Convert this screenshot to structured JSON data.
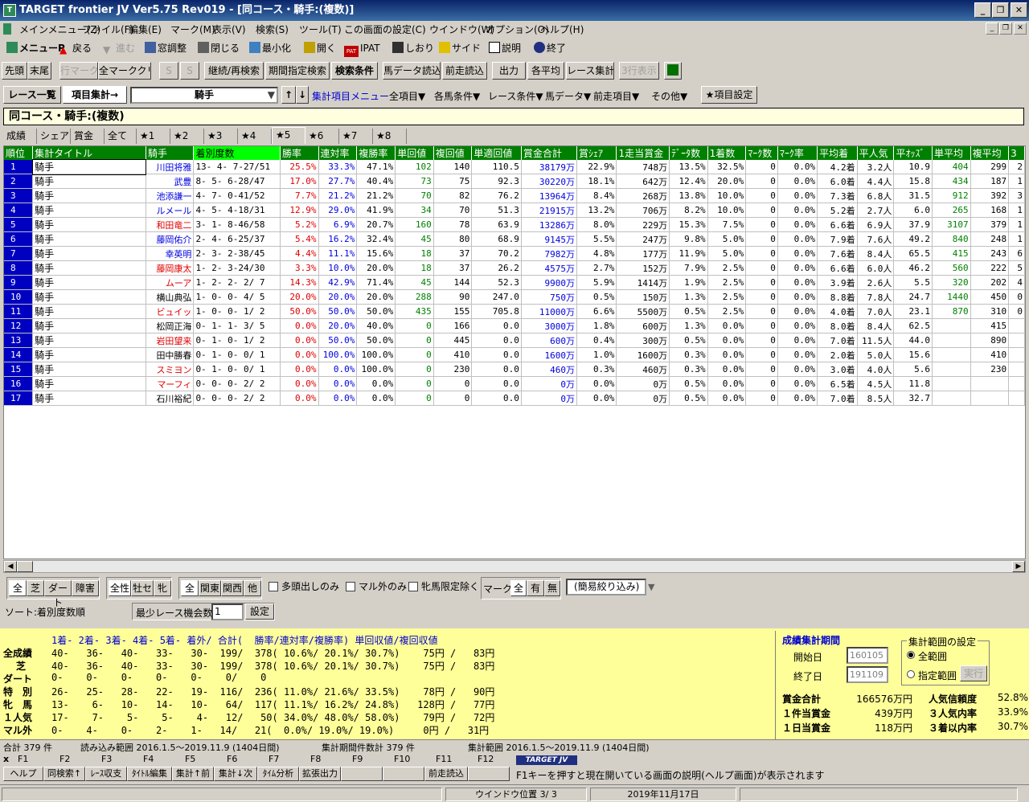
{
  "window": {
    "title": "TARGET frontier JV  Ver5.75  Rev019 - [同コース・騎手:(複数)]"
  },
  "menu": [
    "メインメニュー(Z)",
    "ファイル(F)",
    "編集(E)",
    "マーク(M)",
    "表示(V)",
    "検索(S)",
    "ツール(T)",
    "この画面の設定(C)",
    "ウインドウ(W)",
    "オプション(O)",
    "ヘルプ(H)"
  ],
  "toolbar1": [
    "メニューP",
    "戻る",
    "進む",
    "窓調整",
    "閉じる",
    "最小化",
    "開く",
    "IPAT",
    "しおり",
    "サイド",
    "説明",
    "終了"
  ],
  "toolbar2": [
    "先頭",
    "末尾",
    "行マーク",
    "全マーククリア",
    "S",
    "S",
    "継続/再検索",
    "期間指定検索",
    "検索条件",
    "馬データ読込",
    "前走読込",
    "出力",
    "各平均",
    "レース集計",
    "3行表示"
  ],
  "toolbar3": {
    "list": "レース一覧",
    "agg": "項目集計→",
    "combo": "騎手",
    "menu_label": "集計項目メニュー",
    "menus": [
      "全項目▼",
      "各馬条件▼",
      "レース条件▼",
      "馬データ▼",
      "前走項目▼",
      "その他▼"
    ],
    "setting": "★項目設定"
  },
  "header": "同コース・騎手:(複数)",
  "tabs": [
    "成績",
    "シェア",
    "賞金",
    "全て",
    "★1",
    "★2",
    "★3",
    "★4",
    "★5",
    "★6",
    "★7",
    "★8"
  ],
  "columns": [
    "順位",
    "集計タイトル",
    "騎手",
    "着別度数",
    "勝率",
    "連対率",
    "複勝率",
    "単回値",
    "複回値",
    "単適回値",
    "賞金合計",
    "賞ｼｪｱ",
    "1走当賞金",
    "ﾃﾞｰﾀ数",
    "1着数",
    "ﾏｰｸ数",
    "ﾏｰｸ率",
    "平均着",
    "平人気",
    "平ｵｯｽﾞ",
    "単平均",
    "複平均",
    "3"
  ],
  "rows": [
    [
      "1",
      "騎手",
      "川田将雅",
      "13- 4- 7-27/51",
      "25.5%",
      "33.3%",
      "47.1%",
      "102",
      "140",
      "110.5",
      "38179万",
      "22.9%",
      "748万",
      "13.5%",
      "32.5%",
      "0",
      "0.0%",
      "4.2着",
      "3.2人",
      "10.9",
      "404",
      "299",
      "2"
    ],
    [
      "2",
      "騎手",
      "武豊",
      "8- 5- 6-28/47",
      "17.0%",
      "27.7%",
      "40.4%",
      "73",
      "75",
      "92.3",
      "30220万",
      "18.1%",
      "642万",
      "12.4%",
      "20.0%",
      "0",
      "0.0%",
      "6.0着",
      "4.4人",
      "15.8",
      "434",
      "187",
      "1"
    ],
    [
      "3",
      "騎手",
      "池添謙一",
      "4- 7- 0-41/52",
      "7.7%",
      "21.2%",
      "21.2%",
      "70",
      "82",
      "76.2",
      "13964万",
      "8.4%",
      "268万",
      "13.8%",
      "10.0%",
      "0",
      "0.0%",
      "7.3着",
      "6.8人",
      "31.5",
      "912",
      "392",
      "3"
    ],
    [
      "4",
      "騎手",
      "ルメール",
      "4- 5- 4-18/31",
      "12.9%",
      "29.0%",
      "41.9%",
      "34",
      "70",
      "51.3",
      "21915万",
      "13.2%",
      "706万",
      "8.2%",
      "10.0%",
      "0",
      "0.0%",
      "5.2着",
      "2.7人",
      "6.0",
      "265",
      "168",
      "1"
    ],
    [
      "5",
      "騎手",
      "和田竜二",
      "3- 1- 8-46/58",
      "5.2%",
      "6.9%",
      "20.7%",
      "160",
      "78",
      "63.9",
      "13286万",
      "8.0%",
      "229万",
      "15.3%",
      "7.5%",
      "0",
      "0.0%",
      "6.6着",
      "6.9人",
      "37.9",
      "3107",
      "379",
      "1"
    ],
    [
      "6",
      "騎手",
      "藤岡佑介",
      "2- 4- 6-25/37",
      "5.4%",
      "16.2%",
      "32.4%",
      "45",
      "80",
      "68.9",
      "9145万",
      "5.5%",
      "247万",
      "9.8%",
      "5.0%",
      "0",
      "0.0%",
      "7.9着",
      "7.6人",
      "49.2",
      "840",
      "248",
      "1"
    ],
    [
      "7",
      "騎手",
      "幸英明",
      "2- 3- 2-38/45",
      "4.4%",
      "11.1%",
      "15.6%",
      "18",
      "37",
      "70.2",
      "7982万",
      "4.8%",
      "177万",
      "11.9%",
      "5.0%",
      "0",
      "0.0%",
      "7.6着",
      "8.4人",
      "65.5",
      "415",
      "243",
      "6"
    ],
    [
      "8",
      "騎手",
      "藤岡康太",
      "1- 2- 3-24/30",
      "3.3%",
      "10.0%",
      "20.0%",
      "18",
      "37",
      "26.2",
      "4575万",
      "2.7%",
      "152万",
      "7.9%",
      "2.5%",
      "0",
      "0.0%",
      "6.6着",
      "6.0人",
      "46.2",
      "560",
      "222",
      "5"
    ],
    [
      "9",
      "騎手",
      "ムーア",
      "1- 2- 2- 2/ 7",
      "14.3%",
      "42.9%",
      "71.4%",
      "45",
      "144",
      "52.3",
      "9900万",
      "5.9%",
      "1414万",
      "1.9%",
      "2.5%",
      "0",
      "0.0%",
      "3.9着",
      "2.6人",
      "5.5",
      "320",
      "202",
      "4"
    ],
    [
      "10",
      "騎手",
      "横山典弘",
      "1- 0- 0- 4/ 5",
      "20.0%",
      "20.0%",
      "20.0%",
      "288",
      "90",
      "247.0",
      "750万",
      "0.5%",
      "150万",
      "1.3%",
      "2.5%",
      "0",
      "0.0%",
      "8.8着",
      "7.8人",
      "24.7",
      "1440",
      "450",
      "0"
    ],
    [
      "11",
      "騎手",
      "ビュイッ",
      "1- 0- 0- 1/ 2",
      "50.0%",
      "50.0%",
      "50.0%",
      "435",
      "155",
      "705.8",
      "11000万",
      "6.6%",
      "5500万",
      "0.5%",
      "2.5%",
      "0",
      "0.0%",
      "4.0着",
      "7.0人",
      "23.1",
      "870",
      "310",
      "0"
    ],
    [
      "12",
      "騎手",
      "松岡正海",
      "0- 1- 1- 3/ 5",
      "0.0%",
      "20.0%",
      "40.0%",
      "0",
      "166",
      "0.0",
      "3000万",
      "1.8%",
      "600万",
      "1.3%",
      "0.0%",
      "0",
      "0.0%",
      "8.0着",
      "8.4人",
      "62.5",
      "",
      "415",
      ""
    ],
    [
      "13",
      "騎手",
      "岩田望来",
      "0- 1- 0- 1/ 2",
      "0.0%",
      "50.0%",
      "50.0%",
      "0",
      "445",
      "0.0",
      "600万",
      "0.4%",
      "300万",
      "0.5%",
      "0.0%",
      "0",
      "0.0%",
      "7.0着",
      "11.5人",
      "44.0",
      "",
      "890",
      ""
    ],
    [
      "14",
      "騎手",
      "田中勝春",
      "0- 1- 0- 0/ 1",
      "0.0%",
      "100.0%",
      "100.0%",
      "0",
      "410",
      "0.0",
      "1600万",
      "1.0%",
      "1600万",
      "0.3%",
      "0.0%",
      "0",
      "0.0%",
      "2.0着",
      "5.0人",
      "15.6",
      "",
      "410",
      ""
    ],
    [
      "15",
      "騎手",
      "スミヨン",
      "0- 1- 0- 0/ 1",
      "0.0%",
      "0.0%",
      "100.0%",
      "0",
      "230",
      "0.0",
      "460万",
      "0.3%",
      "460万",
      "0.3%",
      "0.0%",
      "0",
      "0.0%",
      "3.0着",
      "4.0人",
      "5.6",
      "",
      "230",
      ""
    ],
    [
      "16",
      "騎手",
      "マーフィ",
      "0- 0- 0- 2/ 2",
      "0.0%",
      "0.0%",
      "0.0%",
      "0",
      "0",
      "0.0",
      "0万",
      "0.0%",
      "0万",
      "0.5%",
      "0.0%",
      "0",
      "0.0%",
      "6.5着",
      "4.5人",
      "11.8",
      "",
      "",
      ""
    ],
    [
      "17",
      "騎手",
      "石川裕紀",
      "0- 0- 0- 2/ 2",
      "0.0%",
      "0.0%",
      "0.0%",
      "0",
      "0",
      "0.0",
      "0万",
      "0.0%",
      "0万",
      "0.5%",
      "0.0%",
      "0",
      "0.0%",
      "7.0着",
      "8.5人",
      "32.7",
      "",
      "",
      ""
    ]
  ],
  "jockey_colors": [
    "blue",
    "blue",
    "blue",
    "blue",
    "red",
    "blue",
    "blue",
    "red",
    "red",
    "black",
    "red",
    "black",
    "red",
    "black",
    "red",
    "red",
    "black"
  ],
  "filters": {
    "g1": [
      "全",
      "芝",
      "ダート",
      "障害"
    ],
    "g2": [
      "全性",
      "牡セ",
      "牝"
    ],
    "g3": [
      "全",
      "関東",
      "関西",
      "他"
    ],
    "checks": [
      "多頭出しのみ",
      "マル外のみ",
      "牝馬限定除く"
    ],
    "mark_label": "マーク",
    "mark_btns": [
      "全",
      "有",
      "無"
    ],
    "simple": "(簡易絞り込み)"
  },
  "sort": {
    "label": "ソート:着別度数順",
    "min_label": "最少レース機会数",
    "min_value": "1",
    "set": "設定"
  },
  "stats": {
    "header": "1着- 2着- 3着- 4着- 5着- 着外/ 合計(  勝率/連対率/複勝率) 単回収値/複回収値",
    "rows": [
      [
        "全成績",
        "40-   36-   40-   33-   30-  199/  378( 10.6%/ 20.1%/ 30.7%)    75円 /   83円"
      ],
      [
        "芝",
        "40-   36-   40-   33-   30-  199/  378( 10.6%/ 20.1%/ 30.7%)    75円 /   83円"
      ],
      [
        "ダート",
        "0-    0-    0-    0-    0-    0/    0"
      ],
      [
        "特　別",
        "26-   25-   28-   22-   19-  116/  236( 11.0%/ 21.6%/ 33.5%)    78円 /   90円"
      ],
      [
        "牝　馬",
        "13-    6-   10-   14-   10-   64/  117( 11.1%/ 16.2%/ 24.8%)   128円 /   77円"
      ],
      [
        "１人気",
        "17-    7-    5-    5-    4-   12/   50( 34.0%/ 48.0%/ 58.0%)    79円 /   72円"
      ],
      [
        "マル外",
        "0-    4-    0-    2-    1-   14/   21(  0.0%/ 19.0%/ 19.0%)     0円 /   31円"
      ]
    ]
  },
  "period": {
    "title": "成績集計期間",
    "start_label": "開始日",
    "start": "160105",
    "end_label": "終了日",
    "end": "191109",
    "scope_title": "集計範囲の設定",
    "scope_all": "全範囲",
    "scope_spec": "指定範囲",
    "exec": "実行"
  },
  "money": [
    [
      "賞金合計",
      "166576万円"
    ],
    [
      "１件当賞金",
      "439万円"
    ],
    [
      "１日当賞金",
      "118万円"
    ]
  ],
  "rates": [
    [
      "人気信頼度",
      "52.8%"
    ],
    [
      "３人気内率",
      "33.9%"
    ],
    [
      "３着以内率",
      "30.7%"
    ]
  ],
  "status2": [
    "合計 379 件",
    "読み込み範囲 2016.1.5～2019.11.9 (1404日間)",
    "集計期間件数計 379 件",
    "集計範囲 2016.1.5～2019.11.9 (1404日間)"
  ],
  "fkeys": [
    "F1",
    "F2",
    "F3",
    "F4",
    "F5",
    "F6",
    "F7",
    "F8",
    "F9",
    "F10",
    "F11",
    "F12"
  ],
  "fbtns": [
    "ヘルプ",
    "同検索↑",
    "ﾚｰｽ収支",
    "ﾀｲﾄﾙ編集",
    "集計↑前",
    "集計↓次",
    "ﾀｲﾑ分析",
    "拡張出力",
    "",
    "",
    "前走読込",
    ""
  ],
  "logo": "TARGET JV",
  "help_text": "F1キーを押すと現在開いている画面の説明(ヘルプ画面)が表示されます",
  "bottom": {
    "window_pos": "ウインドウ位置 3/ 3",
    "date": "2019年11月17日"
  }
}
